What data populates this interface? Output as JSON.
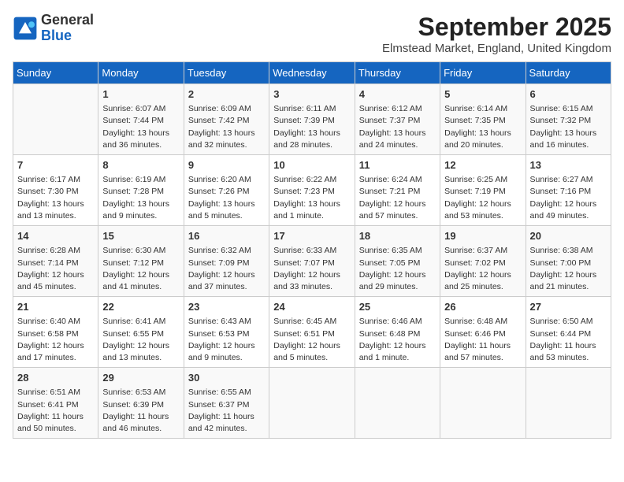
{
  "logo": {
    "line1": "General",
    "line2": "Blue"
  },
  "title": "September 2025",
  "subtitle": "Elmstead Market, England, United Kingdom",
  "days_of_week": [
    "Sunday",
    "Monday",
    "Tuesday",
    "Wednesday",
    "Thursday",
    "Friday",
    "Saturday"
  ],
  "weeks": [
    [
      {
        "day": "",
        "content": ""
      },
      {
        "day": "1",
        "content": "Sunrise: 6:07 AM\nSunset: 7:44 PM\nDaylight: 13 hours\nand 36 minutes."
      },
      {
        "day": "2",
        "content": "Sunrise: 6:09 AM\nSunset: 7:42 PM\nDaylight: 13 hours\nand 32 minutes."
      },
      {
        "day": "3",
        "content": "Sunrise: 6:11 AM\nSunset: 7:39 PM\nDaylight: 13 hours\nand 28 minutes."
      },
      {
        "day": "4",
        "content": "Sunrise: 6:12 AM\nSunset: 7:37 PM\nDaylight: 13 hours\nand 24 minutes."
      },
      {
        "day": "5",
        "content": "Sunrise: 6:14 AM\nSunset: 7:35 PM\nDaylight: 13 hours\nand 20 minutes."
      },
      {
        "day": "6",
        "content": "Sunrise: 6:15 AM\nSunset: 7:32 PM\nDaylight: 13 hours\nand 16 minutes."
      }
    ],
    [
      {
        "day": "7",
        "content": "Sunrise: 6:17 AM\nSunset: 7:30 PM\nDaylight: 13 hours\nand 13 minutes."
      },
      {
        "day": "8",
        "content": "Sunrise: 6:19 AM\nSunset: 7:28 PM\nDaylight: 13 hours\nand 9 minutes."
      },
      {
        "day": "9",
        "content": "Sunrise: 6:20 AM\nSunset: 7:26 PM\nDaylight: 13 hours\nand 5 minutes."
      },
      {
        "day": "10",
        "content": "Sunrise: 6:22 AM\nSunset: 7:23 PM\nDaylight: 13 hours\nand 1 minute."
      },
      {
        "day": "11",
        "content": "Sunrise: 6:24 AM\nSunset: 7:21 PM\nDaylight: 12 hours\nand 57 minutes."
      },
      {
        "day": "12",
        "content": "Sunrise: 6:25 AM\nSunset: 7:19 PM\nDaylight: 12 hours\nand 53 minutes."
      },
      {
        "day": "13",
        "content": "Sunrise: 6:27 AM\nSunset: 7:16 PM\nDaylight: 12 hours\nand 49 minutes."
      }
    ],
    [
      {
        "day": "14",
        "content": "Sunrise: 6:28 AM\nSunset: 7:14 PM\nDaylight: 12 hours\nand 45 minutes."
      },
      {
        "day": "15",
        "content": "Sunrise: 6:30 AM\nSunset: 7:12 PM\nDaylight: 12 hours\nand 41 minutes."
      },
      {
        "day": "16",
        "content": "Sunrise: 6:32 AM\nSunset: 7:09 PM\nDaylight: 12 hours\nand 37 minutes."
      },
      {
        "day": "17",
        "content": "Sunrise: 6:33 AM\nSunset: 7:07 PM\nDaylight: 12 hours\nand 33 minutes."
      },
      {
        "day": "18",
        "content": "Sunrise: 6:35 AM\nSunset: 7:05 PM\nDaylight: 12 hours\nand 29 minutes."
      },
      {
        "day": "19",
        "content": "Sunrise: 6:37 AM\nSunset: 7:02 PM\nDaylight: 12 hours\nand 25 minutes."
      },
      {
        "day": "20",
        "content": "Sunrise: 6:38 AM\nSunset: 7:00 PM\nDaylight: 12 hours\nand 21 minutes."
      }
    ],
    [
      {
        "day": "21",
        "content": "Sunrise: 6:40 AM\nSunset: 6:58 PM\nDaylight: 12 hours\nand 17 minutes."
      },
      {
        "day": "22",
        "content": "Sunrise: 6:41 AM\nSunset: 6:55 PM\nDaylight: 12 hours\nand 13 minutes."
      },
      {
        "day": "23",
        "content": "Sunrise: 6:43 AM\nSunset: 6:53 PM\nDaylight: 12 hours\nand 9 minutes."
      },
      {
        "day": "24",
        "content": "Sunrise: 6:45 AM\nSunset: 6:51 PM\nDaylight: 12 hours\nand 5 minutes."
      },
      {
        "day": "25",
        "content": "Sunrise: 6:46 AM\nSunset: 6:48 PM\nDaylight: 12 hours\nand 1 minute."
      },
      {
        "day": "26",
        "content": "Sunrise: 6:48 AM\nSunset: 6:46 PM\nDaylight: 11 hours\nand 57 minutes."
      },
      {
        "day": "27",
        "content": "Sunrise: 6:50 AM\nSunset: 6:44 PM\nDaylight: 11 hours\nand 53 minutes."
      }
    ],
    [
      {
        "day": "28",
        "content": "Sunrise: 6:51 AM\nSunset: 6:41 PM\nDaylight: 11 hours\nand 50 minutes."
      },
      {
        "day": "29",
        "content": "Sunrise: 6:53 AM\nSunset: 6:39 PM\nDaylight: 11 hours\nand 46 minutes."
      },
      {
        "day": "30",
        "content": "Sunrise: 6:55 AM\nSunset: 6:37 PM\nDaylight: 11 hours\nand 42 minutes."
      },
      {
        "day": "",
        "content": ""
      },
      {
        "day": "",
        "content": ""
      },
      {
        "day": "",
        "content": ""
      },
      {
        "day": "",
        "content": ""
      }
    ]
  ]
}
